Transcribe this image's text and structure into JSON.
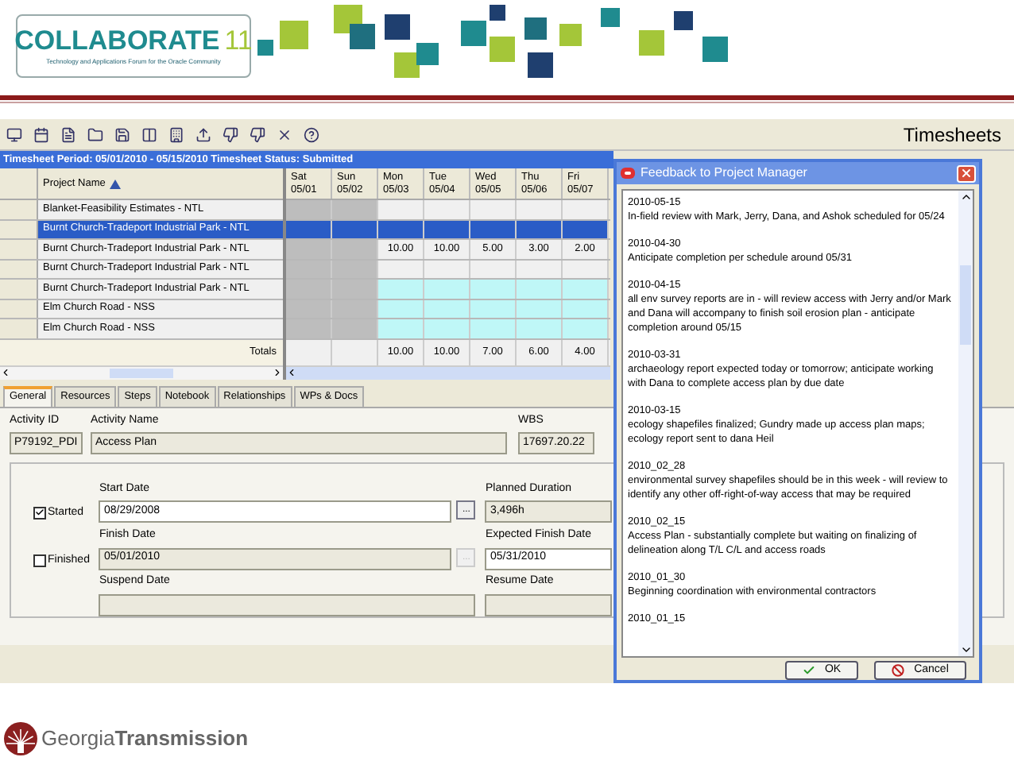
{
  "header": {
    "logo_text": "COLLABORATE",
    "logo_number": "11",
    "tagline": "Technology and Applications Forum for the Oracle Community"
  },
  "app": {
    "title": "Timesheets",
    "period_bar": "Timesheet Period: 05/01/2010 - 05/15/2010  Timesheet Status: Submitted",
    "grid": {
      "name_column": "Project Name",
      "days": [
        {
          "day": "Sat",
          "date": "05/01",
          "weekend": true
        },
        {
          "day": "Sun",
          "date": "05/02",
          "weekend": true
        },
        {
          "day": "Mon",
          "date": "05/03",
          "weekend": false
        },
        {
          "day": "Tue",
          "date": "05/04",
          "weekend": false
        },
        {
          "day": "Wed",
          "date": "05/05",
          "weekend": false
        },
        {
          "day": "Thu",
          "date": "05/06",
          "weekend": false
        },
        {
          "day": "Fri",
          "date": "05/07",
          "weekend": false
        }
      ],
      "rows": [
        {
          "name": "Blanket-Feasibility Estimates - NTL",
          "selected": false,
          "highlighted": false
        },
        {
          "name": "Burnt Church-Tradeport Industrial Park - NTL",
          "selected": true
        },
        {
          "name": "Burnt Church-Tradeport Industrial Park - NTL",
          "selected": false,
          "highlighted": false,
          "hours": [
            "10.00",
            "10.00",
            "5.00",
            "3.00",
            "2.00"
          ]
        },
        {
          "name": "Burnt Church-Tradeport Industrial Park - NTL",
          "selected": false,
          "highlighted": false
        },
        {
          "name": "Burnt Church-Tradeport Industrial Park - NTL",
          "selected": false,
          "highlighted": true
        },
        {
          "name": "Elm Church Road - NSS",
          "selected": false,
          "highlighted": true
        },
        {
          "name": "Elm Church Road - NSS",
          "selected": false,
          "highlighted": true
        }
      ],
      "totals_label": "Totals",
      "totals": [
        "10.00",
        "10.00",
        "7.00",
        "6.00",
        "4.00"
      ]
    },
    "tabs": [
      {
        "label": "General",
        "selected": true
      },
      {
        "label": "Resources",
        "selected": false
      },
      {
        "label": "Steps",
        "selected": false
      },
      {
        "label": "Notebook",
        "selected": false
      },
      {
        "label": "Relationships",
        "selected": false
      },
      {
        "label": "WPs & Docs",
        "selected": false
      }
    ],
    "activity": {
      "id_label": "Activity ID",
      "id": "P79192_PDI",
      "name_label": "Activity Name",
      "name": "Access Plan",
      "wbs_label": "WBS",
      "wbs": "17697.20.22"
    },
    "dates": {
      "started": {
        "label": "Started",
        "checked": true
      },
      "start_date_label": "Start Date",
      "start_date": "08/29/2008",
      "browse": "...",
      "planned_duration_label": "Planned Duration",
      "planned_duration": "3,496h",
      "finished": {
        "label": "Finished",
        "checked": false
      },
      "finish_date_label": "Finish Date",
      "finish_date": "05/01/2010",
      "finish_browse": "...",
      "expected_finish_label": "Expected Finish Date",
      "expected_finish": "05/31/2010",
      "suspend_label": "Suspend Date",
      "resume_label": "Resume Date"
    }
  },
  "dialog": {
    "title": "Feedback to Project Manager",
    "entries": [
      {
        "date": "2010-05-15",
        "text": "In-field review with Mark, Jerry, Dana, and Ashok scheduled for 05/24"
      },
      {
        "date": "2010-04-30",
        "text": "Anticipate completion per schedule around 05/31"
      },
      {
        "date": "2010-04-15",
        "text": "all env survey reports are in - will review access with Jerry and/or Mark and Dana will accompany to finish soil erosion plan - anticipate completion around 05/15"
      },
      {
        "date": "2010-03-31",
        "text": "archaeology report expected today or tomorrow; anticipate working with Dana to complete access plan by due date"
      },
      {
        "date": "2010-03-15",
        "text": "ecology shapefiles finalized; Gundry made up access plan maps; ecology report sent to dana Heil"
      },
      {
        "date": "2010_02_28",
        "text": "environmental survey shapefiles should be in this week - will review to identify any other off-right-of-way access that may be required"
      },
      {
        "date": "2010_02_15",
        "text": "Access Plan - substantially complete but waiting on finalizing of delineation along T/L C/L and access roads"
      },
      {
        "date": "2010_01_30",
        "text": "Beginning coordination with environmental contractors"
      },
      {
        "date": "2010_01_15"
      }
    ],
    "ok": "OK",
    "cancel": "Cancel"
  },
  "footer": {
    "logo": "Georgia**Transmission**"
  }
}
